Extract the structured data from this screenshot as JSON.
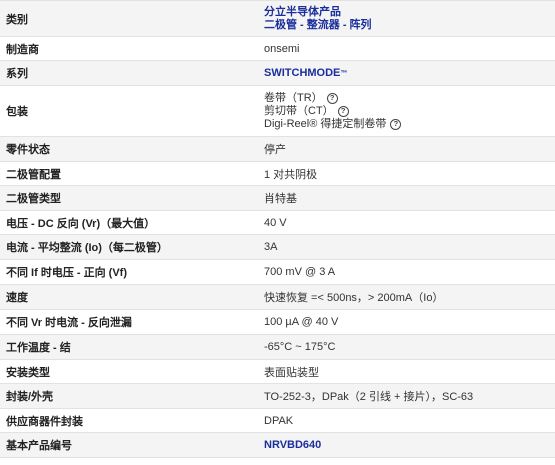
{
  "rows": [
    {
      "label": "类别",
      "values": [
        "分立半导体产品",
        "二极管 - 整流器 - 阵列"
      ]
    },
    {
      "label": "制造商",
      "value": "onsemi"
    },
    {
      "label": "系列",
      "value": "SWITCHMODE",
      "suffix": "™"
    },
    {
      "label": "包装",
      "packaging": [
        "卷带（TR）",
        "剪切带（CT）",
        "Digi-Reel® 得捷定制卷带"
      ]
    },
    {
      "label": "零件状态",
      "value": "停产"
    },
    {
      "label": "二极管配置",
      "value": "1 对共阴极"
    },
    {
      "label": "二极管类型",
      "value": "肖特基"
    },
    {
      "label": "电压 - DC 反向 (Vr)（最大值）",
      "value": "40 V"
    },
    {
      "label": "电流 - 平均整流 (Io)（每二极管）",
      "value": "3A"
    },
    {
      "label": "不同 If 时电压 - 正向 (Vf)",
      "value": "700 mV @ 3 A"
    },
    {
      "label": "速度",
      "value": "快速恢复 =< 500ns，> 200mA（Io）"
    },
    {
      "label": "不同 Vr 时电流 - 反向泄漏",
      "value": "100 µA @ 40 V"
    },
    {
      "label": "工作温度 - 结",
      "value": "-65°C ~ 175°C"
    },
    {
      "label": "安装类型",
      "value": "表面贴装型"
    },
    {
      "label": "封装/外壳",
      "value": "TO-252-3，DPak（2 引线 + 接片），SC-63"
    },
    {
      "label": "供应商器件封装",
      "value": "DPAK"
    },
    {
      "label": "基本产品编号",
      "value": "NRVBD640"
    }
  ],
  "icons": {
    "help": "question-circle-icon"
  },
  "help_glyph": "?"
}
